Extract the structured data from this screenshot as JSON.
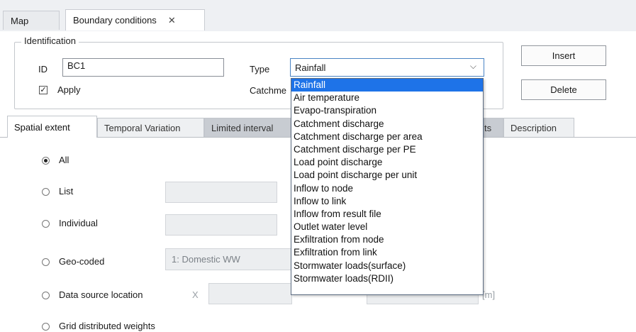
{
  "doc_tabs": [
    {
      "label": "Map"
    },
    {
      "label": "Boundary conditions",
      "close": "✕"
    }
  ],
  "identification": {
    "legend": "Identification",
    "id_label": "ID",
    "id_value": "BC1",
    "apply_label": "Apply",
    "apply_checked": true,
    "type_label": "Type",
    "type_value": "Rainfall",
    "catchment_label": "Catchme",
    "insert_label": "Insert",
    "delete_label": "Delete"
  },
  "inner_tabs": [
    {
      "label": "Spatial extent"
    },
    {
      "label": "Temporal Variation"
    },
    {
      "label": "Limited interval"
    },
    {
      "label": "ts"
    },
    {
      "label": "Description"
    }
  ],
  "spatial": {
    "options": [
      {
        "label": "All",
        "selected": true
      },
      {
        "label": "List"
      },
      {
        "label": "Individual"
      },
      {
        "label": "Geo-coded"
      },
      {
        "label": "Data source location"
      },
      {
        "label": "Grid distributed weights"
      }
    ],
    "geo_value": "1: Domestic WW",
    "x_label": "X",
    "unit_label": "[m]"
  },
  "dropdown": {
    "items": [
      "Rainfall",
      "Air temperature",
      "Evapo-transpiration",
      "Catchment discharge",
      "Catchment discharge per area",
      "Catchment discharge per PE",
      "Load point discharge",
      "Load point discharge per unit",
      "Inflow to node",
      "Inflow to link",
      "Inflow from result file",
      "Outlet water level",
      "Exfiltration from node",
      "Exfiltration from link",
      "Stormwater loads(surface)",
      "Stormwater loads(RDII)"
    ],
    "selected_index": 0
  },
  "icons": {
    "close": "close-icon",
    "chevron": "chevron-down-icon",
    "check": "checkmark-icon"
  },
  "colors": {
    "selection": "#1e73e8",
    "combo_border": "#4a84c4"
  }
}
